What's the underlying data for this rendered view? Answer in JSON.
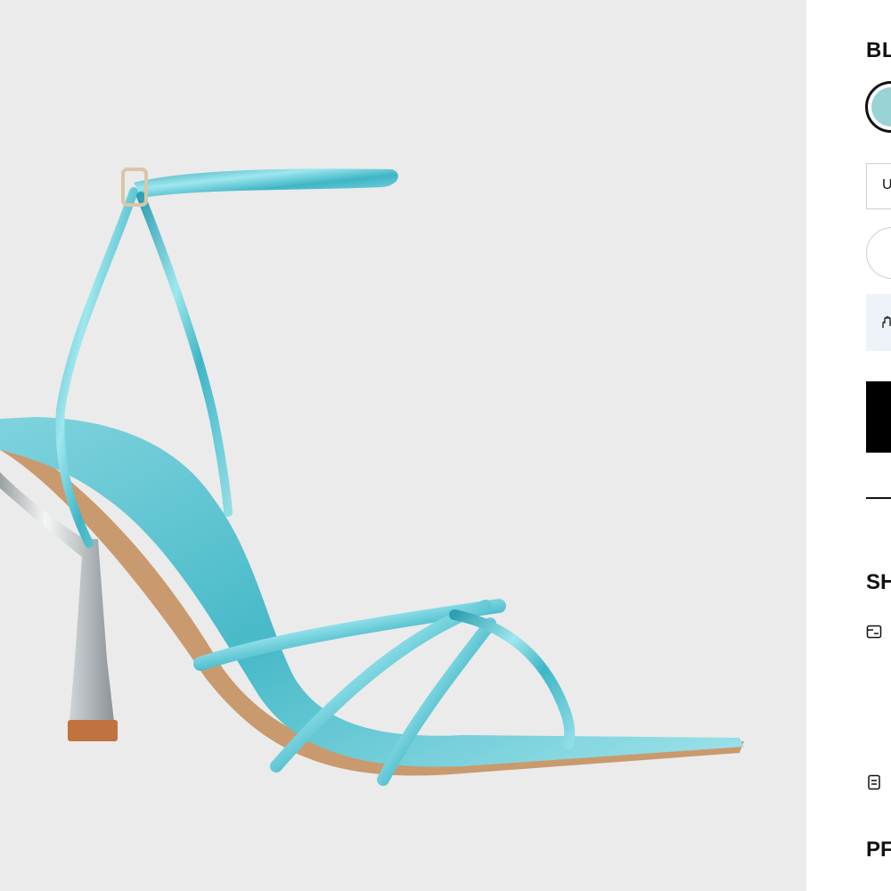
{
  "product": {
    "color_heading": "BL",
    "swatch_color": "#9ad3d6",
    "size_select_label": "U",
    "notice_icon": "hand-icon"
  },
  "sections": {
    "shipping_heading": "SH",
    "product_heading": "PF",
    "shipping_icon": "delivery-card-icon",
    "returns_icon": "document-icon"
  },
  "colors": {
    "image_background": "#ebebeb",
    "metallic_blue": "#5cc7d3",
    "heel_silver": "#c9cdd0",
    "button_black": "#000000",
    "notice_background": "#eef3f9"
  }
}
